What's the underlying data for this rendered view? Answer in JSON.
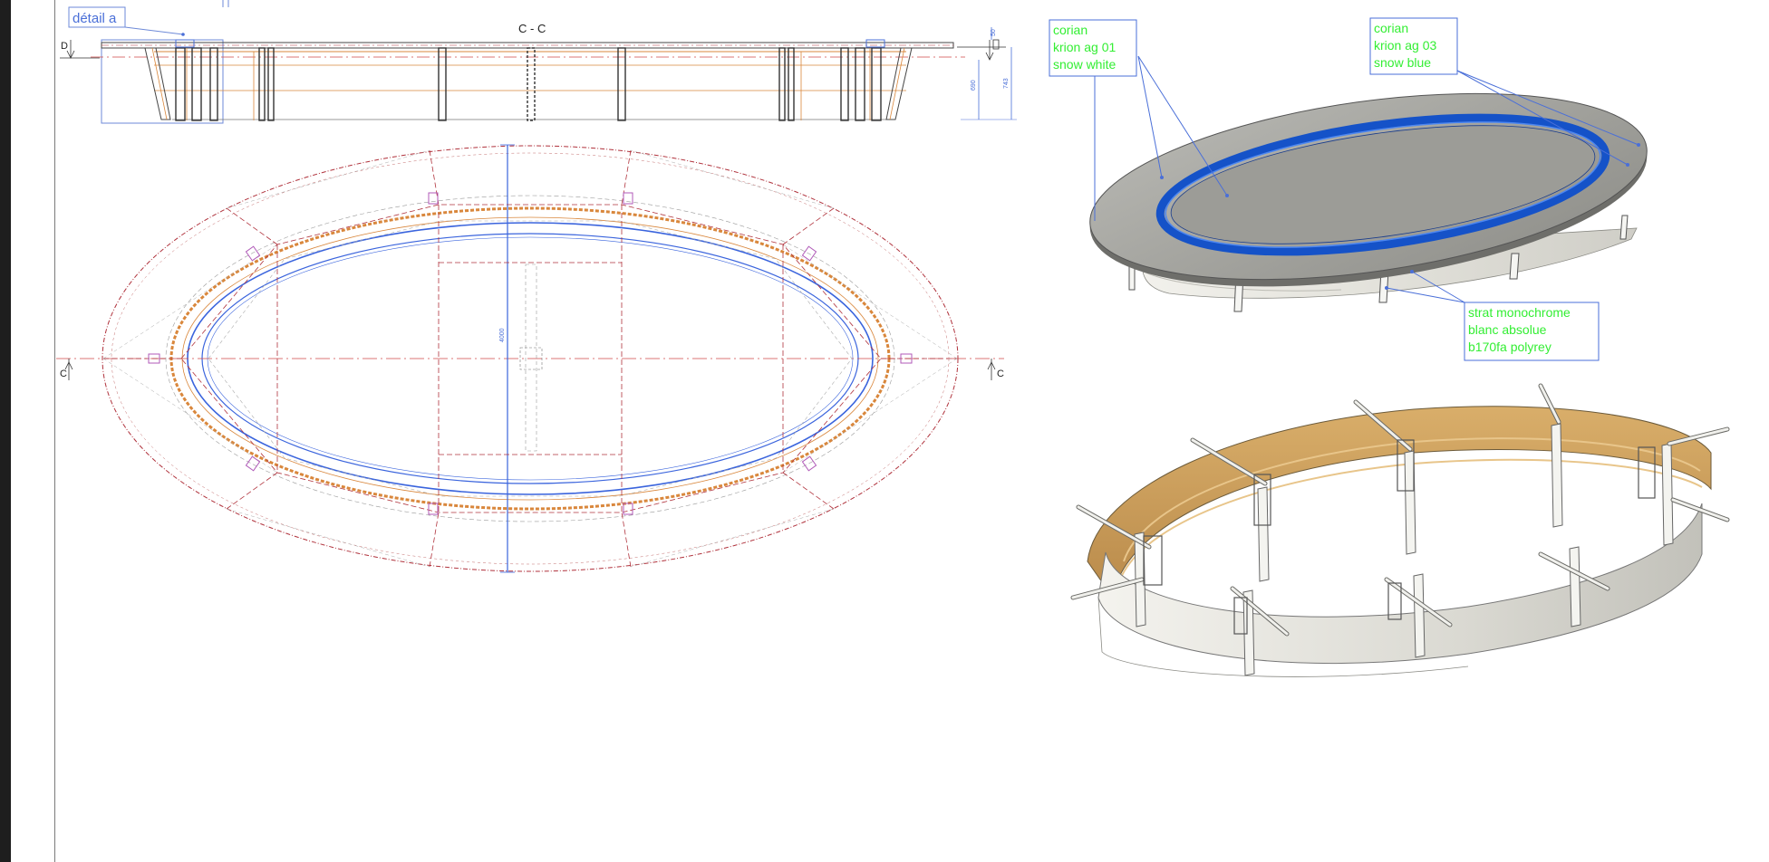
{
  "section_view": {
    "title": "C - C",
    "detail_label": "détail a",
    "marker_left": "D",
    "dim_small": "50",
    "dim_middle": "690",
    "dim_total": "743"
  },
  "plan_view": {
    "section_mark": "C",
    "dim_width": "4000"
  },
  "callouts": [
    {
      "lines": [
        "corian",
        "krion ag 01",
        "snow white"
      ]
    },
    {
      "lines": [
        "corian",
        "krion ag 03",
        "snow blue"
      ]
    },
    {
      "lines": [
        "strat monochrome",
        "blanc absolue",
        "b170fa polyrey"
      ]
    }
  ],
  "colors": {
    "annotation_green": "#33ee33",
    "annotation_blue": "#4a6fd8",
    "outline_red": "#b0323c",
    "frame_orange": "#d9873c",
    "top_grey": "#a3a39e",
    "ring_blue": "#1552c8",
    "wood": "#c99a5a"
  }
}
